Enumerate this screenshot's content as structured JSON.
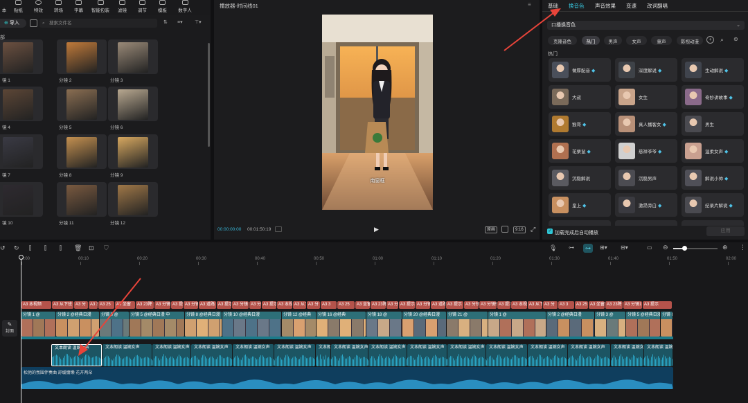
{
  "toolbar": {
    "items": [
      "本",
      "贴纸",
      "特效",
      "转场",
      "字幕",
      "智能包装",
      "滤镜",
      "调节",
      "模板",
      "数字人"
    ]
  },
  "media": {
    "import_label": "导入",
    "search_placeholder": "搜索文件名",
    "section_label": "部",
    "thumbs": [
      "镜 1",
      "分镜 2",
      "分镜 3",
      "镜 4",
      "分镜 5",
      "分镜 6",
      "镜 7",
      "分镜 8",
      "分镜 9",
      "镜 10",
      "分镜 11",
      "分镜 12"
    ]
  },
  "player": {
    "title": "播放器-时间线01",
    "subtitle_in_video": "南窗框",
    "current_time": "00:00:00:00",
    "total_time": "00:01:50:19",
    "ratio": "9:16",
    "quality_btn": "原画"
  },
  "right_panel": {
    "tabs": [
      "基础",
      "换音色",
      "声音效果",
      "变速",
      "改词翻唱"
    ],
    "active_tab": "换音色",
    "dropdown": "口播换音色",
    "chips": [
      "克隆音色",
      "热门",
      "男声",
      "女声",
      "童声",
      "影视动漫"
    ],
    "active_chip": "热门",
    "section_hot": "热门",
    "voices": [
      "做厚配音",
      "深度解说",
      "生动解说",
      "大叔",
      "女生",
      "奇妙讲故事",
      "猴哥",
      "真人播客女",
      "男生",
      "花栗鼠",
      "慈祥爷爷",
      "温柔女声",
      "沉稳解说",
      "沉稳男声",
      "解说小帅",
      "皇上",
      "激昂旁白",
      "纪录片解说"
    ],
    "auto_play_label": "加载完成后自动播放",
    "apply_btn": "应用"
  },
  "timeline": {
    "ruler": [
      "00:00",
      "00:10",
      "00:20",
      "00:30",
      "00:40",
      "00:50",
      "01:00",
      "01:10",
      "01:20",
      "01:30",
      "01:40",
      "01:50",
      "02:00"
    ],
    "cover_label": "封面",
    "text_clips": [
      "A3 本视频",
      "A3 从下班",
      "A3 分",
      "A3 3",
      "A3 25",
      "A3 坐窗",
      "A3 23降",
      "A3 分镜1",
      "A3 提示",
      "A3 分镜 1",
      "A3 道路",
      "A3 提示",
      "A3 分镜 1",
      "A3 分镜5",
      "A3 提示"
    ],
    "video_clips": [
      "分镜 1 @",
      "分镜 2 @经典日漫",
      "分镜 3 @",
      "分镜 5 @经典日漫 中",
      "分镜 8 @经典日漫",
      "分镜 10 @经典日漫",
      "分镜 12 @经典",
      "分镜 16 @经典",
      "分镜 18 @",
      "分镜 20 @经典日漫",
      "分镜 21 @"
    ],
    "audio_clip_label": "文本朗读 温婉女声",
    "music_label": "松弛的氛围伴奏曲 舒缓慵懒 花开两朵"
  }
}
